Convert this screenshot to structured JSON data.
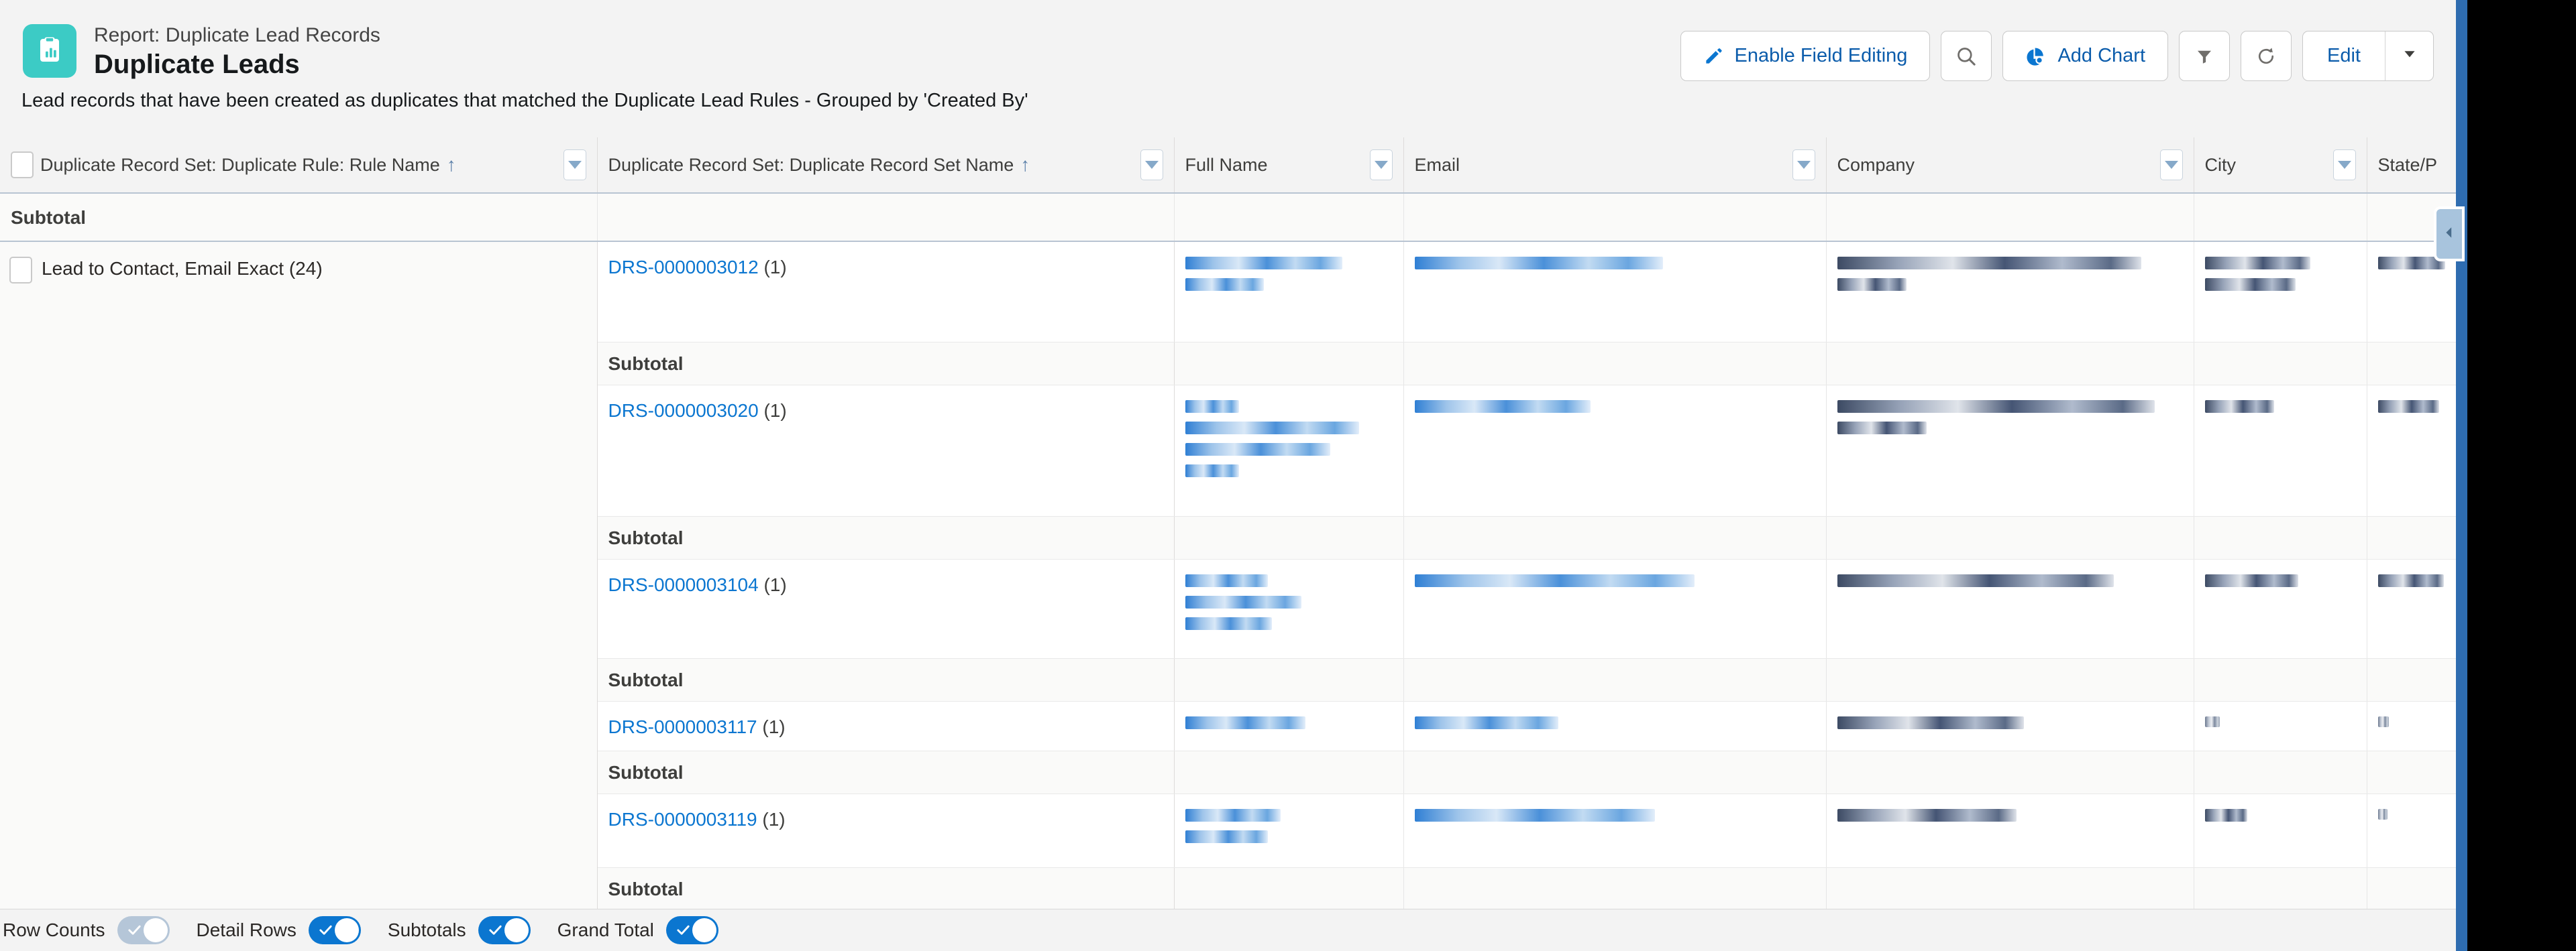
{
  "header": {
    "eyebrow": "Report: Duplicate Lead Records",
    "title": "Duplicate Leads",
    "subtitle": "Lead records that have been created as duplicates that matched the Duplicate Lead Rules - Grouped by 'Created By'",
    "icon": "report-clipboard-chart-icon",
    "icon_color": "#3ccbc5",
    "actions": {
      "enable_field_editing": "Enable Field Editing",
      "search": "search-icon",
      "add_chart": "Add Chart",
      "filter": "filter-icon",
      "refresh": "refresh-icon",
      "edit": "Edit",
      "edit_menu": "chevron-down-icon"
    }
  },
  "table": {
    "columns": [
      {
        "label": "Duplicate Record Set: Duplicate Rule: Rule Name",
        "sort": "↑",
        "menu": true
      },
      {
        "label": "Duplicate Record Set: Duplicate Record Set Name",
        "sort": "↑",
        "menu": true
      },
      {
        "label": "Full Name",
        "sort": "",
        "menu": true
      },
      {
        "label": "Email",
        "sort": "",
        "menu": true
      },
      {
        "label": "Company",
        "sort": "",
        "menu": true
      },
      {
        "label": "City",
        "sort": "",
        "menu": true
      },
      {
        "label": "State/P",
        "sort": "",
        "menu": false
      }
    ],
    "grand_subtotal_label": "Subtotal",
    "subtotal_label": "Subtotal",
    "group": {
      "label": "Lead to Contact, Email Exact (24)"
    },
    "rows": [
      {
        "set_name": "DRS-0000003012",
        "count": "(1)"
      },
      {
        "set_name": "DRS-0000003020",
        "count": "(1)"
      },
      {
        "set_name": "DRS-0000003104",
        "count": "(1)"
      },
      {
        "set_name": "DRS-0000003117",
        "count": "(1)"
      },
      {
        "set_name": "DRS-0000003119",
        "count": "(1)"
      }
    ]
  },
  "footer": {
    "toggles": [
      {
        "label": "Row Counts",
        "state": "off"
      },
      {
        "label": "Detail Rows",
        "state": "on"
      },
      {
        "label": "Subtotals",
        "state": "on"
      },
      {
        "label": "Grand Total",
        "state": "on"
      }
    ]
  },
  "colors": {
    "accent_blue": "#0b76d0",
    "link_blue": "#0b76d0",
    "icon_teal": "#3ccbc5",
    "header_bg": "#f3f3f3",
    "divider": "#b8c4d2"
  }
}
